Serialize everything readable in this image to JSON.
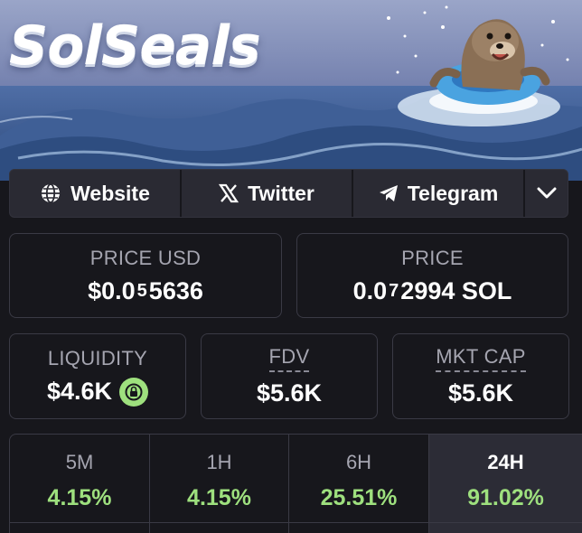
{
  "banner": {
    "title": "SolSeals"
  },
  "links": {
    "website": "Website",
    "twitter": "Twitter",
    "telegram": "Telegram"
  },
  "price_usd": {
    "label": "PRICE USD",
    "prefix": "$0.0",
    "zeros": "5",
    "digits": "5636"
  },
  "price_native": {
    "label": "PRICE",
    "prefix": "0.0",
    "zeros": "7",
    "digits": "2994 SOL"
  },
  "liquidity": {
    "label": "LIQUIDITY",
    "value": "$4.6K"
  },
  "fdv": {
    "label": "FDV",
    "value": "$5.6K"
  },
  "mkt_cap": {
    "label": "MKT CAP",
    "value": "$5.6K"
  },
  "timeframes": [
    {
      "label": "5M",
      "change": "4.15%",
      "active": false
    },
    {
      "label": "1H",
      "change": "4.15%",
      "active": false
    },
    {
      "label": "6H",
      "change": "25.51%",
      "active": false
    },
    {
      "label": "24H",
      "change": "91.02%",
      "active": true
    }
  ],
  "colors": {
    "positive": "#9ee07e",
    "background": "#17171c",
    "panel": "#2a2a33"
  }
}
